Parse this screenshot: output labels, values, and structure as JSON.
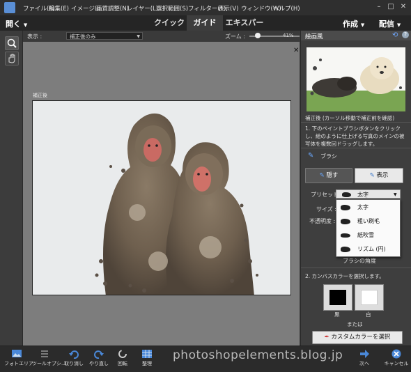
{
  "menubar": {
    "items": [
      "ファイル(F)",
      "編集(E)",
      "イメージ(I)",
      "画質調整(N)",
      "レイヤー(L)",
      "選択範囲(S)",
      "フィルター(T)",
      "表示(V)",
      "ウィンドウ(W)",
      "ヘルプ(H)"
    ]
  },
  "modebar": {
    "open_label": "開く",
    "tabs": [
      "クイック",
      "ガイド",
      "エキスパート"
    ],
    "active_tab": "ガイド",
    "create_label": "作成",
    "share_label": "配信"
  },
  "optbar": {
    "view_label": "表示 :",
    "view_value": "補正後のみ",
    "zoom_label": "ズーム :",
    "zoom_value": "41%",
    "zoom_level_fraction": 0.41
  },
  "canvas": {
    "after_label": "補正後"
  },
  "panel": {
    "title": "絵画風",
    "thumb_caption": "補正後 (カーソル移動で補正前を確認)",
    "step1_text": "1. 下のペイントブラシボタンをクリックし、絵のように仕上げる写真のメインの被写体を複数回ドラッグします。",
    "brush_label": "ブラシ",
    "hide_label": "隠す",
    "show_label": "表示",
    "preset_label": "プリセット :",
    "preset_value": "太字",
    "size_label": "サイズ :",
    "opacity_label": "不透明度 :",
    "brush_angle_label": "ブラシの角度",
    "step2_text": "2. カンバスカラーを選択します。",
    "black_label": "黒",
    "white_label": "白",
    "or_label": "または",
    "custom_color_label": "カスタムカラーを選択",
    "dropdown_items": [
      "太字",
      "粗い刷毛",
      "紙吹雪",
      "リズム (円)"
    ]
  },
  "bottom": {
    "buttons": [
      "フォトエリア",
      "ツールオプシ...",
      "取り消し",
      "やり直し",
      "回転",
      "整理",
      "次へ",
      "キャンセル"
    ]
  },
  "watermark": "photoshopelements.blog.jp"
}
